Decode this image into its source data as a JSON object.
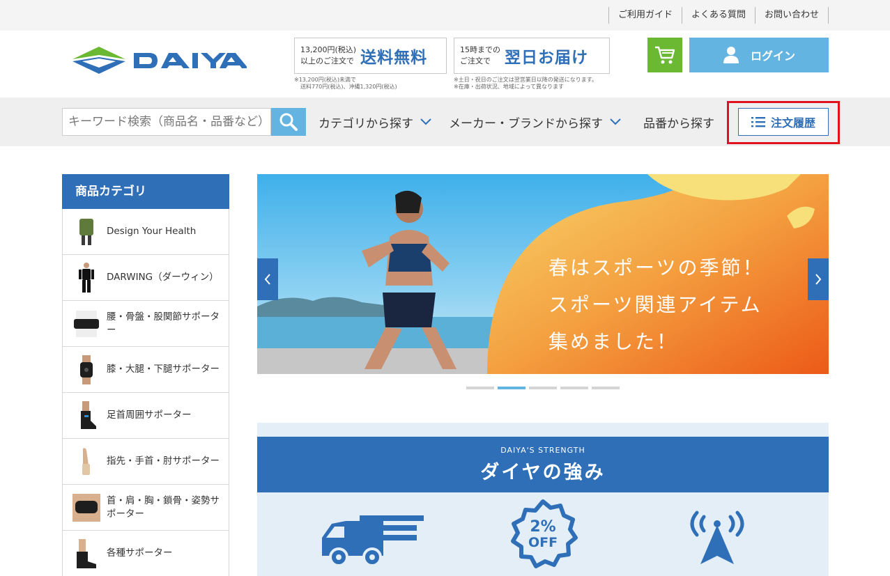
{
  "top_links": [
    "ご利用ガイド",
    "よくある質問",
    "お問い合わせ"
  ],
  "brand": {
    "name": "DAIYA",
    "color": "#2f6fb7",
    "accent_green": "#6bb833"
  },
  "promo_shipping": {
    "small_line1": "13,200円(税込)",
    "small_line2": "以上のご注文で",
    "big": "送料無料",
    "note_line1": "※13,200円(税込)未満で",
    "note_line2": "送料770円(税込)、沖縄1,320円(税込)"
  },
  "promo_delivery": {
    "small_line1": "15時までの",
    "small_line2": "ご注文で",
    "big": "翌日お届け",
    "note_line1": "※土日・祝日のご注文は翌営業日以降の発送になります。",
    "note_line2": "※在庫・出荷状況、地域によって異なります"
  },
  "header": {
    "login_label": "ログイン",
    "cart_icon": "cart-icon"
  },
  "nav": {
    "search_placeholder": "キーワード検索（商品名・品番など）",
    "category_label": "カテゴリから探す",
    "maker_label": "メーカー・ブランドから探す",
    "part_number_label": "品番から探す",
    "order_history_label": "注文履歴"
  },
  "sidebar": {
    "title": "商品カテゴリ",
    "items": [
      {
        "label": "Design Your Health"
      },
      {
        "label": "DARWING（ダーウィン）"
      },
      {
        "label": "腰・骨盤・股関節サポーター"
      },
      {
        "label": "膝・大腿・下腿サポーター"
      },
      {
        "label": "足首周囲サポーター"
      },
      {
        "label": "指先・手首・肘サポーター"
      },
      {
        "label": "首・肩・胸・鎖骨・姿勢サポーター"
      },
      {
        "label": "各種サポーター"
      }
    ]
  },
  "banner": {
    "line1": "春はスポーツの季節！",
    "line2": "スポーツ関連アイテム",
    "line3": "集めました！",
    "active_slide": 2,
    "slide_count": 5
  },
  "strength": {
    "subtitle": "DAIYA'S STRENGTH",
    "title": "ダイヤの強み",
    "badge_top": "2%",
    "badge_bottom": "OFF"
  }
}
